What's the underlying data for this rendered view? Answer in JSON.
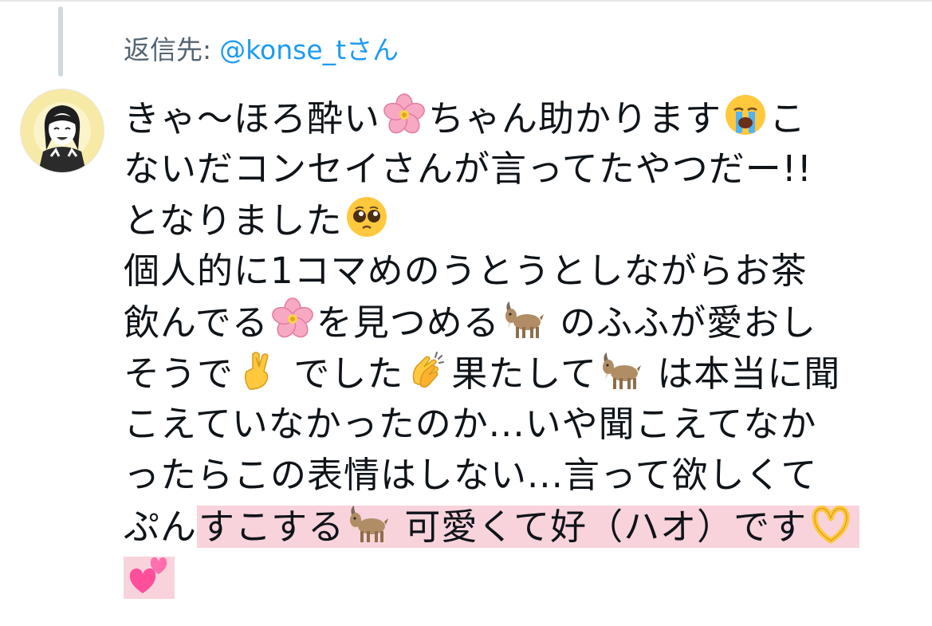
{
  "reply": {
    "prefix": "返信先:",
    "handle": "@konse_tさん"
  },
  "tweet": {
    "line1": {
      "a": "きゃ〜ほろ酔い",
      "b": "ちゃん助かります",
      "c": "こ"
    },
    "line2": "ないだコンセイさんが言ってたやつだー!!",
    "line3": {
      "a": "となりました"
    },
    "line4": "個人的に1コマめのうとうとしながらお茶",
    "line5": {
      "a": "飲んでる",
      "b": "を見つめる",
      "c": " のふふが愛おし"
    },
    "line6": {
      "a": "そうで",
      "b": " でした",
      "c": "果たして",
      "d": " は本当に聞"
    },
    "line7": "こえていなかったのか...いや聞こえてなか",
    "line8": "ったらこの表情はしない...言って欲しくて",
    "line9": {
      "a": "ぷん",
      "b": "すこする",
      "c": " 可愛くて好（ハオ）です"
    }
  },
  "emojis": {
    "cherry_blossom": "cherry-blossom-icon",
    "crying_face": "loudly-crying-face-icon",
    "pleading_face": "pleading-face-icon",
    "goat": "goat-icon",
    "crossed_fingers": "crossed-fingers-icon",
    "clapping_hands": "clapping-hands-icon",
    "heart_hands": "heart-hands-icon",
    "two_hearts": "two-hearts-icon"
  },
  "colors": {
    "text": "#0f1419",
    "secondary_text": "#536471",
    "link": "#1d9bf0",
    "highlight": "#f8d3dc",
    "thread_line": "#cfd9de"
  }
}
